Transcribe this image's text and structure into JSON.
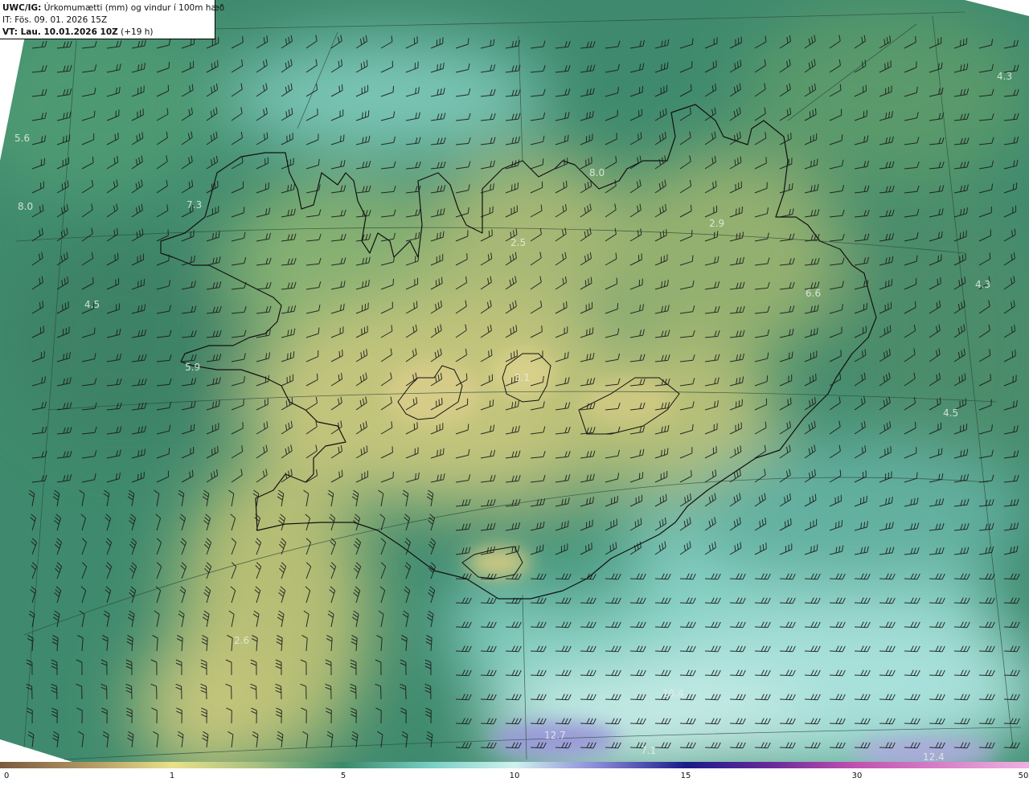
{
  "header": {
    "title_bold": "UWC/IG:",
    "title_rest": " Úrkomumætti (mm) og vindur í 100m hæð",
    "it_line": "IT: Fös. 09. 01. 2026 15Z",
    "vt_bold": "VT: Lau. 10.01.2026 10Z",
    "vt_rest": " (+19 h)"
  },
  "map_values": [
    "5.6",
    "8.0",
    "7.3",
    "4.5",
    "5.9",
    "8.0",
    "2.9",
    "4.3",
    "4.3",
    "6.6",
    "4.5",
    "2.6",
    "10.4",
    "12.7",
    "7.1",
    "12.4",
    "2.5",
    "3.1"
  ],
  "colorbar": {
    "ticks": [
      "0",
      "1",
      "5",
      "10",
      "15",
      "30",
      "50"
    ],
    "colors": [
      "#7a5a3c",
      "#c8b070",
      "#e8e08a",
      "#a8c080",
      "#3a8a6a",
      "#7acfc4",
      "#c8f0ee",
      "#8a8ad8",
      "#1a1a8a",
      "#8a2aa0",
      "#e080c8",
      "#f0b0e0"
    ]
  }
}
